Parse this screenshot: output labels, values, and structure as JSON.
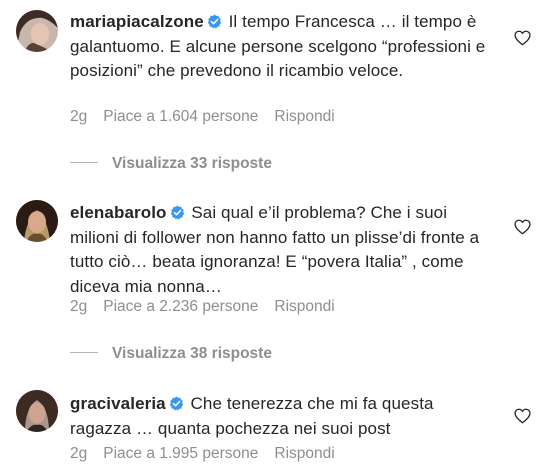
{
  "comments": [
    {
      "username": "mariapiacalzone",
      "text": "Il tempo Francesca … il tempo  è galantuomo. E alcune persone scelgono “professioni e posizioni” che prevedono il ricambio veloce.",
      "time": "2g",
      "likes": "Piace a 1.604 persone",
      "reply": "Rispondi",
      "view_replies": "Visualizza 33 risposte"
    },
    {
      "username": "elenabarolo",
      "text": "Sai qual e’il problema? Che i suoi milioni di follower non hanno fatto un plisse’di fronte a tutto ciò… beata ignoranza! E “povera Italia” , come diceva mia nonna…",
      "time": "2g",
      "likes": "Piace a 2.236 persone",
      "reply": "Rispondi",
      "view_replies": "Visualizza 38 risposte"
    },
    {
      "username": "gracivaleria",
      "text": "Che tenerezza che mi fa questa ragazza … quanta pochezza nei suoi post",
      "time": "2g",
      "likes": "Piace a 1.995 persone",
      "reply": "Rispondi"
    }
  ],
  "colors": {
    "verified": "#3897f0",
    "muted": "#8e8e8e",
    "text": "#262626"
  },
  "icons": {
    "verified": "verified-badge-icon",
    "like": "heart-outline-icon"
  }
}
